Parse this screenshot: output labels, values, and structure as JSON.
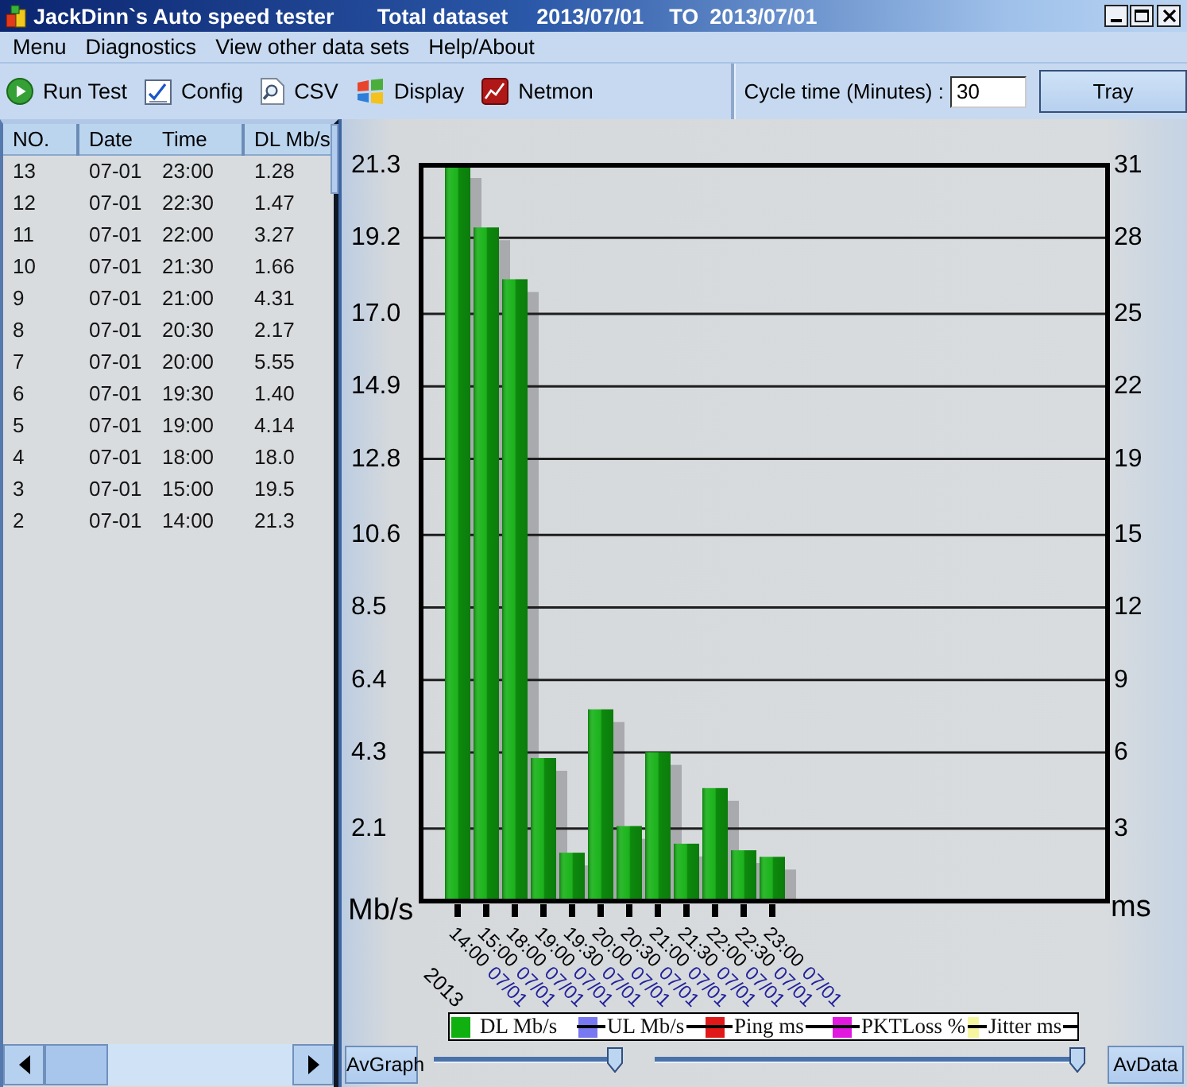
{
  "window": {
    "title": "JackDinn`s Auto speed tester",
    "dataset_label": "Total dataset",
    "date_from": "2013/07/01",
    "range_word": "TO",
    "date_to": "2013/07/01"
  },
  "menu": [
    "Menu",
    "Diagnostics",
    "View other data sets",
    "Help/About"
  ],
  "toolbar": {
    "buttons": [
      {
        "kind": "run",
        "label": "Run Test"
      },
      {
        "kind": "config",
        "label": "Config"
      },
      {
        "kind": "csv",
        "label": "CSV"
      },
      {
        "kind": "display",
        "label": "Display"
      },
      {
        "kind": "netmon",
        "label": "Netmon"
      }
    ],
    "cycle_label": "Cycle time (Minutes) :",
    "cycle_value": "30",
    "tray_button": "Tray"
  },
  "table": {
    "columns": [
      "NO.",
      "Date",
      "Time",
      "DL Mb/s"
    ],
    "rows": [
      [
        "13",
        "07-01",
        "23:00",
        "1.28"
      ],
      [
        "12",
        "07-01",
        "22:30",
        "1.47"
      ],
      [
        "11",
        "07-01",
        "22:00",
        "3.27"
      ],
      [
        "10",
        "07-01",
        "21:30",
        "1.66"
      ],
      [
        "9",
        "07-01",
        "21:00",
        "4.31"
      ],
      [
        "8",
        "07-01",
        "20:30",
        "2.17"
      ],
      [
        "7",
        "07-01",
        "20:00",
        "5.55"
      ],
      [
        "6",
        "07-01",
        "19:30",
        "1.40"
      ],
      [
        "5",
        "07-01",
        "19:00",
        "4.14"
      ],
      [
        "4",
        "07-01",
        "18:00",
        "18.0"
      ],
      [
        "3",
        "07-01",
        "15:00",
        "19.5"
      ],
      [
        "2",
        "07-01",
        "14:00",
        "21.3"
      ]
    ]
  },
  "chart": {
    "chart_data": {
      "type": "bar",
      "ylabel": "Mb/s",
      "categories": [
        "14:00",
        "15:00",
        "18:00",
        "19:00",
        "19:30",
        "20:00",
        "20:30",
        "21:00",
        "21:30",
        "22:00",
        "22:30",
        "23:00"
      ],
      "series": [
        {
          "name": "DL Mb/s",
          "color": "#10b010",
          "values": [
            21.3,
            19.5,
            18.0,
            4.14,
            1.4,
            5.55,
            2.17,
            4.31,
            1.66,
            3.27,
            1.47,
            1.28
          ]
        }
      ],
      "ylim": [
        0,
        21.3
      ],
      "yticks": [
        2.1,
        4.3,
        6.4,
        8.5,
        10.6,
        12.8,
        14.9,
        {
          "value": 17.0,
          "label": "17.0"
        },
        19.2,
        21.3
      ],
      "grid": true
    },
    "date_labels": [
      "07/01",
      "07/01",
      "07/01",
      "07/01",
      "07/01",
      "07/01",
      "07/01",
      "07/01",
      "07/01",
      "07/01",
      "07/01",
      "07/01"
    ],
    "year_label": "2013",
    "right_axis": {
      "label": "ms",
      "ticks": [
        "31",
        "28",
        "25",
        "22",
        "19",
        "15",
        "12",
        "9",
        "6",
        "3"
      ]
    },
    "other_series": [
      {
        "label": "UL Mb/s",
        "color": "#7878f0",
        "shown": false
      },
      {
        "label": "Ping ms",
        "color": "#e01818",
        "shown": false
      },
      {
        "label": "PKTLoss %",
        "color": "#e018e0",
        "shown": false
      },
      {
        "label": "Jitter ms",
        "color": "#f6f6a0",
        "shown": false
      }
    ]
  },
  "controls": {
    "avgraph_button": "AvGraph",
    "sliders": [
      {
        "level": 0.96
      },
      {
        "level": 0.98
      }
    ],
    "avdata_button": "AvData"
  }
}
